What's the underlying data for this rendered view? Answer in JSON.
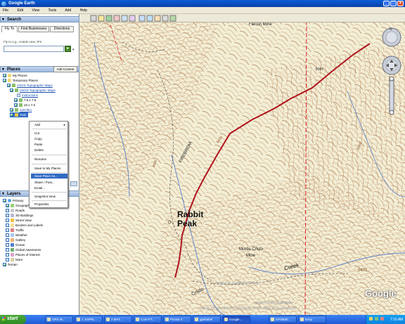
{
  "window": {
    "title": "Google Earth",
    "close": "×",
    "max": "□",
    "min": "_"
  },
  "menu": [
    "File",
    "Edit",
    "View",
    "Tools",
    "Add",
    "Help"
  ],
  "search": {
    "header": "Search",
    "tabs": [
      "Fly To",
      "Find Businesses",
      "Directions"
    ],
    "hint": "Fly to e.g., Hotels near JFK"
  },
  "places": {
    "header": "Places",
    "add_content": "Add Content",
    "items": [
      {
        "label": "My Places"
      },
      {
        "label": "Temporary Places"
      },
      {
        "label": "USGS Topographic Maps"
      },
      {
        "label": "USGS Topographic Maps"
      },
      {
        "label": "Instructions"
      },
      {
        "label": "7.5 x 7.5"
      },
      {
        "label": "15 x 7.5"
      },
      {
        "label": "sd41l9r1"
      },
      {
        "label": "Trail"
      }
    ]
  },
  "context_menu": {
    "items": [
      "Add",
      "Cut",
      "Copy",
      "Paste",
      "Delete",
      "Rename",
      "Save to My Places",
      "Save Place As...",
      "Share / Post...",
      "Email...",
      "Snapshot View",
      "Properties"
    ]
  },
  "layers": {
    "header": "Layers",
    "items": [
      "Primary",
      "Geographic",
      "Roads",
      "3D Buildings",
      "Street View",
      "Borders and Labels",
      "Traffic",
      "Weather",
      "Gallery",
      "Ocean",
      "Global Awareness",
      "Places of Interest",
      "More",
      "Terrain"
    ]
  },
  "map": {
    "watermark": "© www.historicmapworks.com",
    "labels": {
      "rabbit1": "Rabbit",
      "rabbit2": "Peak",
      "firebreak": "FIREBREAK",
      "monte1": "Monte Cristo",
      "monte2": "Mine",
      "creek": "Creek",
      "falcon": "Falcon Mine",
      "e5400a": "5400",
      "e5400b": "5400",
      "e5000": "5000",
      "e4600": "4600",
      "e6007": "6007",
      "cristo": "Cristo",
      "copyright": "Image © 2009 DigitalGlobe",
      "usgs": "Image U.S. Geological Survey",
      "pointer": "Pointer  34°20'12.80\" N  117°57'03.38\" W  elev 5392 ft  Eye alt 10413 ft"
    },
    "logo": "Google",
    "route_color": "#b0141c",
    "boundary_color": "#e0202a"
  },
  "taskbar": {
    "start": "start",
    "tasks": [
      "GPS W...",
      "1. ESPN...",
      "2 MAT...",
      "Core FT...",
      "Picasa 3",
      "gpsbabel",
      "Google...",
      "GPSBab...",
      "temp"
    ],
    "clock": "7:16 AM"
  }
}
